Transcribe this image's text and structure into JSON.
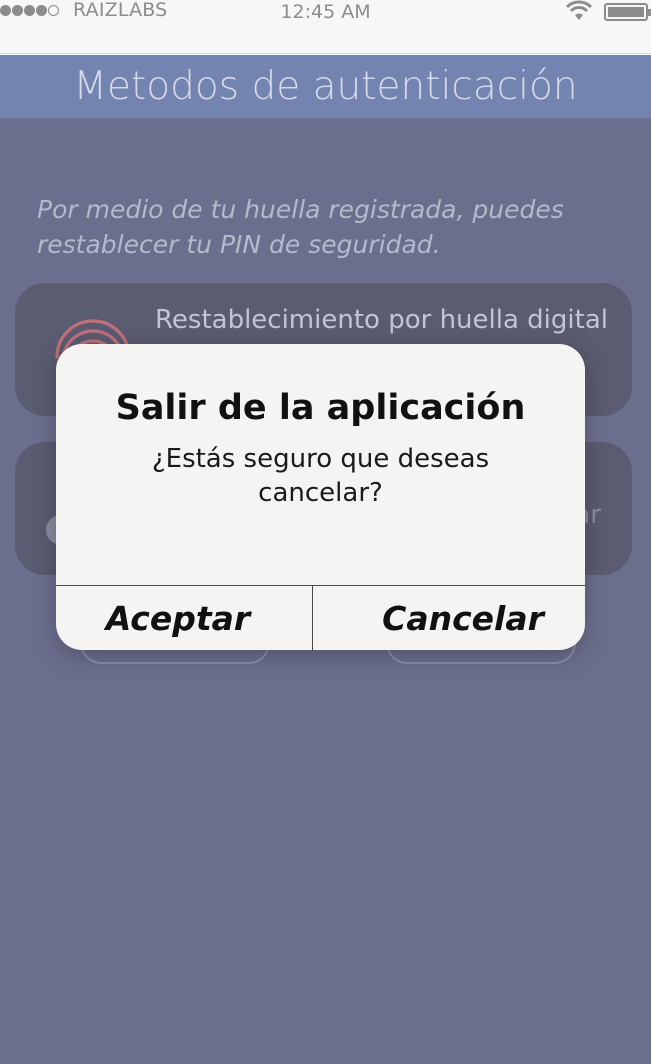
{
  "status_bar": {
    "carrier": "RAIZLABS",
    "time": "12:45 AM",
    "signal_icon": "signal-dots-icon",
    "wifi_icon": "wifi-icon",
    "battery_icon": "battery-icon"
  },
  "header": {
    "title": "Metodos de autenticación"
  },
  "intro_text": "Por medio de tu huella registrada, puedes restablecer tu PIN de seguridad.",
  "cards": [
    {
      "label": "Restablecimiento por huella digital",
      "icon": "fingerprint-icon"
    },
    {
      "label": "ar",
      "icon": "toggle-icon"
    }
  ],
  "alert": {
    "title": "Salir de la aplicación",
    "message": "¿Estás seguro que deseas cancelar?",
    "accept_label": "Aceptar",
    "cancel_label": "Cancelar"
  },
  "colors": {
    "header_bg": "#7384b1",
    "screen_dim": "#6c6e8e",
    "alert_bg": "#f5f4f2",
    "fingerprint": "#c0707a"
  }
}
